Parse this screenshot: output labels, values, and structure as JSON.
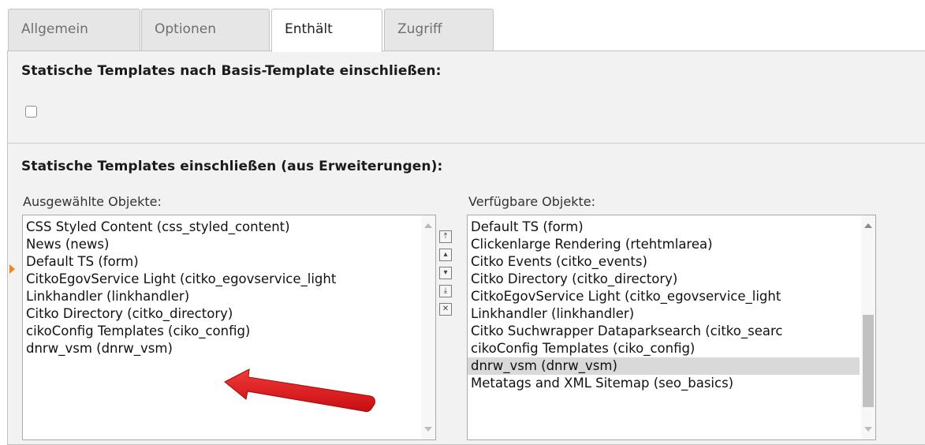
{
  "tabs": [
    {
      "label": "Allgemein",
      "active": false
    },
    {
      "label": "Optionen",
      "active": false
    },
    {
      "label": "Enthält",
      "active": true
    },
    {
      "label": "Zugriff",
      "active": false
    }
  ],
  "section1": {
    "heading": "Statische Templates nach Basis-Template einschließen:",
    "checkbox_checked": false
  },
  "section2": {
    "heading": "Statische Templates einschließen (aus Erweiterungen):",
    "selected_label": "Ausgewählte Objekte:",
    "available_label": "Verfügbare Objekte:",
    "selected_items": [
      "CSS Styled Content (css_styled_content)",
      "News (news)",
      "Default TS (form)",
      "CitkoEgovService Light (citko_egovservice_light",
      "Linkhandler (linkhandler)",
      "Citko Directory (citko_directory)",
      "cikoConfig Templates (ciko_config)",
      "dnrw_vsm (dnrw_vsm)"
    ],
    "available_items": [
      "Default TS (form)",
      "Clickenlarge Rendering (rtehtmlarea)",
      "Citko Events (citko_events)",
      "Citko Directory (citko_directory)",
      "CitkoEgovService Light (citko_egovservice_light",
      "Linkhandler (linkhandler)",
      "Citko Suchwrapper Dataparksearch (citko_searc",
      "cikoConfig Templates (ciko_config)",
      "dnrw_vsm (dnrw_vsm)",
      "Metatags and XML Sitemap (seo_basics)"
    ],
    "available_highlighted_index": 8,
    "control_buttons": [
      {
        "icon": "move-to-top-icon",
        "glyph": "⤒"
      },
      {
        "icon": "move-up-icon",
        "glyph": "▴"
      },
      {
        "icon": "move-down-icon",
        "glyph": "▾"
      },
      {
        "icon": "move-to-bottom-icon",
        "glyph": "⤓"
      },
      {
        "icon": "remove-icon",
        "glyph": "✕"
      }
    ]
  },
  "colors": {
    "annotation_arrow": "#e0141a",
    "selection_marker": "#e88a1a",
    "highlight_row": "#d9d9d9"
  }
}
